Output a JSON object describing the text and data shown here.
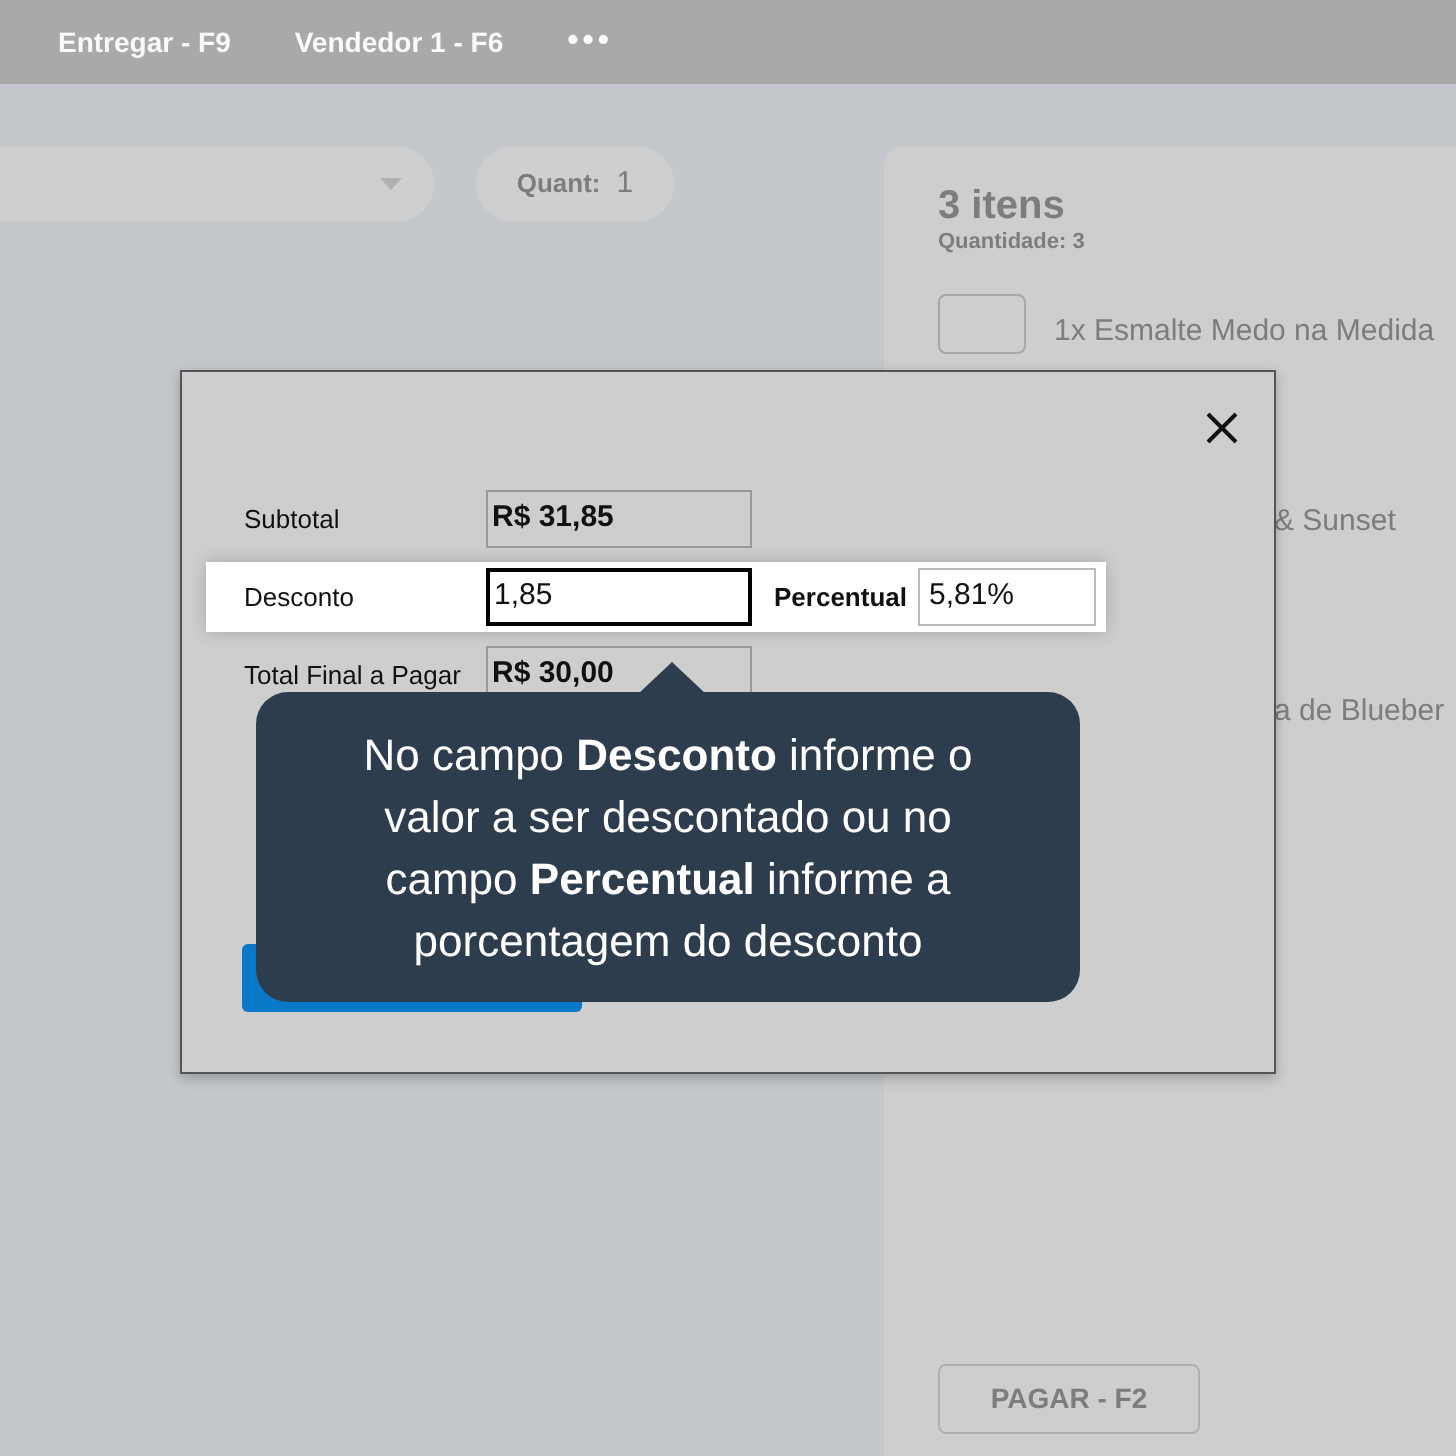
{
  "topbar": {
    "items": [
      {
        "label": "Entregar - F9"
      },
      {
        "label": "Vendedor 1 - F6"
      }
    ],
    "more": "•••"
  },
  "product_bar": {
    "quantity_label": "Quant:",
    "quantity": "1"
  },
  "cart": {
    "title": "3 itens",
    "subtitle": "Quantidade: 3",
    "items": [
      {
        "kind": "thumb",
        "text": "1x Esmalte Medo na Medida"
      },
      {
        "kind": "partial",
        "text": "& Sunset"
      },
      {
        "kind": "partial",
        "text": "a de Blueber"
      }
    ],
    "pay_button": "PAGAR - F2"
  },
  "modal": {
    "rows": [
      {
        "label": "Subtotal",
        "value": "R$ 31,85",
        "highlighted": false,
        "focused": false
      },
      {
        "label": "Desconto",
        "value": "1,85",
        "highlighted": true,
        "focused": true,
        "extra_label": "Percentual",
        "extra_value": "5,81%"
      },
      {
        "label": "Total Final a Pagar",
        "value": "R$ 30,00",
        "highlighted": false,
        "focused": false
      }
    ]
  },
  "tooltip": {
    "text": "No campo **Desconto** informe o valor a ser descontado ou no campo **Percentual** informe a porcentagem do desconto"
  }
}
